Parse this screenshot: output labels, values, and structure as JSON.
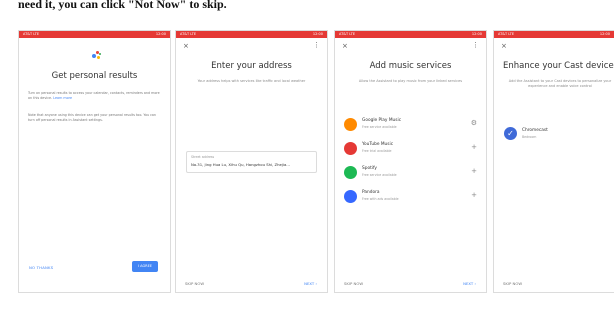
{
  "caption": "need it, you can click \"Not Now\" to skip.",
  "screens": [
    {
      "status_left": "AT&T LTE",
      "status_right": "12:00",
      "title": "Get personal results",
      "para1": "Turn on personal results to access your calendar, contacts, reminders and more on this device.",
      "para1_link": "Learn more",
      "para2": "Note that anyone using this device can get your personal results too. You can turn off personal results in Assistant settings.",
      "left_btn": "NO THANKS",
      "right_btn": "I AGREE"
    },
    {
      "status_left": "AT&T LTE",
      "status_right": "12:00",
      "close": "×",
      "menu": "⋮",
      "title": "Enter your address",
      "sub": "Your address helps with services like traffic and local weather",
      "field_label": "Street address",
      "field_value": "No.31, Jing Hua Lu, Xihu Qu, Hangzhou Shi, Zhejia...",
      "footer_left": "SKIP NOW",
      "footer_right": "NEXT"
    },
    {
      "status_left": "AT&T LTE",
      "status_right": "12:00",
      "close": "×",
      "menu": "⋮",
      "title": "Add music services",
      "sub": "Allow the Assistant to play music from your linked services",
      "services": [
        {
          "name": "Google Play Music",
          "sub": "Free service available",
          "action": "⚙",
          "icon": "google-play-music-icon",
          "color": "#ff8a00"
        },
        {
          "name": "YouTube Music",
          "sub": "Free trial available",
          "action": "+",
          "icon": "youtube-music-icon",
          "color": "#e53935"
        },
        {
          "name": "Spotify",
          "sub": "Free service available",
          "action": "+",
          "icon": "spotify-icon",
          "color": "#1db954"
        },
        {
          "name": "Pandora",
          "sub": "Free with ads available",
          "action": "+",
          "icon": "pandora-icon",
          "color": "#3668ff"
        }
      ],
      "footer_left": "SKIP NOW",
      "footer_right": "NEXT"
    },
    {
      "status_left": "AT&T LTE",
      "status_right": "12:00",
      "close": "×",
      "title": "Enhance your Cast devices",
      "sub": "Add the Assistant to your Cast devices to personalize your experience and enable voice control",
      "device_name": "Chromecast",
      "device_sub": "Bedroom",
      "device_check": "✓",
      "footer_left": "SKIP NOW",
      "footer_right": "NEXT"
    }
  ]
}
